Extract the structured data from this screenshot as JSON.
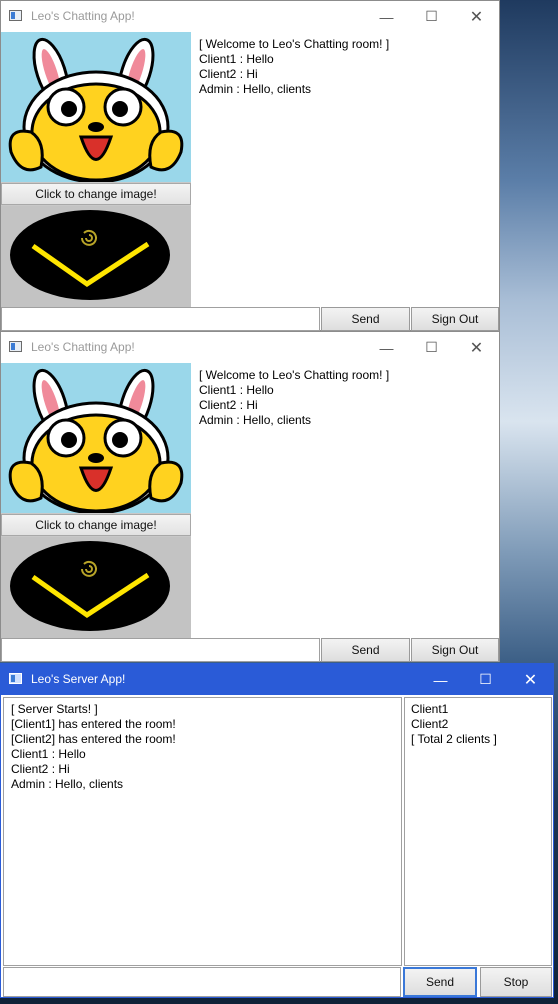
{
  "client_windows": [
    {
      "title": "Leo's Chatting App!",
      "change_image_label": "Click to change image!",
      "chat_lines": [
        "[ Welcome to Leo's Chatting room! ]",
        "Client1 : Hello",
        "Client2 : Hi",
        "Admin : Hello, clients"
      ],
      "input_value": "",
      "send_label": "Send",
      "signout_label": "Sign Out"
    },
    {
      "title": "Leo's Chatting App!",
      "change_image_label": "Click to change image!",
      "chat_lines": [
        "[ Welcome to Leo's Chatting room! ]",
        "Client1 : Hello",
        "Client2 : Hi",
        "Admin : Hello, clients"
      ],
      "input_value": "",
      "send_label": "Send",
      "signout_label": "Sign Out"
    }
  ],
  "server_window": {
    "title": "Leo's Server App!",
    "log_lines": [
      "[ Server Starts! ]",
      "[Client1] has entered the room!",
      "[Client2] has entered the room!",
      "Client1 : Hello",
      "Client2 : Hi",
      "Admin : Hello, clients"
    ],
    "client_list": [
      "Client1",
      "Client2",
      "[ Total 2 clients ]"
    ],
    "input_value": "",
    "send_label": "Send",
    "stop_label": "Stop"
  },
  "window_controls": {
    "minimize_icon": "—",
    "maximize_icon": "☐",
    "close_icon": "✕"
  },
  "icons": [
    "app-window-icon",
    "cartoon-avatar-image",
    "gold-chevron-logo-image"
  ],
  "colors": {
    "server_titlebar": "#2a5bd7",
    "avatar_bg": "#9ad7ea",
    "logo_ellipse": "#000000",
    "logo_chevron": "#ffe600"
  }
}
